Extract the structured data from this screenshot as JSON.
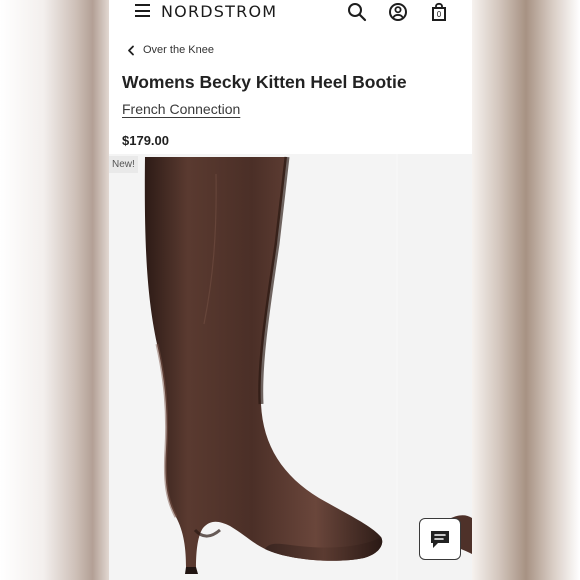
{
  "header": {
    "logo": "NORDSTROM",
    "bag_count": "0"
  },
  "breadcrumb": {
    "label": "Over the Knee"
  },
  "product": {
    "title": "Womens Becky Kitten Heel Bootie",
    "brand": "French Connection",
    "price": "$179.00",
    "badge": "New!"
  },
  "icons": {
    "menu": "menu-icon",
    "search": "search-icon",
    "account": "account-icon",
    "bag": "shopping-bag-icon",
    "back": "chevron-left-icon",
    "chat": "chat-icon"
  },
  "colors": {
    "boot": "#4b2f26",
    "text": "#222222"
  }
}
